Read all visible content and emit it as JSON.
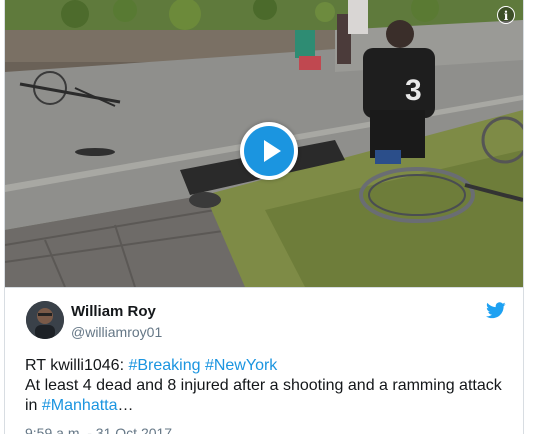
{
  "media": {
    "info_icon": "i",
    "play_icon": "play-icon",
    "jersey_number": "3"
  },
  "author": {
    "name": "William Roy",
    "handle": "@williamroy01"
  },
  "tweet": {
    "line1_prefix": "RT kwilli1046: ",
    "hashtag_breaking": "#Breaking",
    "hashtag_newyork": "#NewYork",
    "line2": "At least 4 dead and 8 injured after a shooting and a ramming attack",
    "line3_prefix": "in ",
    "hashtag_manhattan": "#Manhatta",
    "ellipsis": "…"
  },
  "timestamp": "9:59 a.m. - 31 Oct 2017",
  "colors": {
    "link": "#1b95e0",
    "text": "#14171a",
    "muted": "#657786",
    "twitter_blue": "#1da1f2"
  }
}
